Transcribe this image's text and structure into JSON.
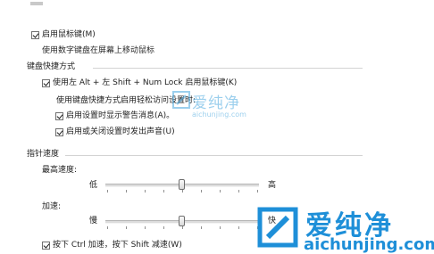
{
  "mouse_keys": {
    "enable_label": "启用鼠标键(M)",
    "description": "使用数字键盘在屏幕上移动鼠标"
  },
  "keyboard_shortcut": {
    "section_title": "键盘快捷方式",
    "alt_shift_label": "使用左 Alt + 左 Shift + Num Lock 启用鼠标键(K)",
    "when_using_label": "使用键盘快捷方式启用轻松访问设置时:",
    "warning_label": "启用设置时显示警告消息(A)。",
    "sound_label": "启用或关闭设置时发出声音(U)"
  },
  "pointer_speed": {
    "section_title": "指针速度",
    "top_speed_label": "最高速度:",
    "low_label": "低",
    "high_label": "高",
    "acceleration_label": "加速:",
    "slow_label": "慢",
    "fast_label": "快",
    "ctrl_shift_label": "按下 Ctrl 加速，按下 Shift 减速(W)"
  },
  "watermark": {
    "small_title": "爱纯净",
    "small_url": "aichunjing.com",
    "big_title": "爱纯净",
    "big_url": "aichunjing.com",
    "color": "#1e8fd8"
  },
  "colors": {
    "rule": "#d3d3d3",
    "text": "#1e1e1e"
  }
}
